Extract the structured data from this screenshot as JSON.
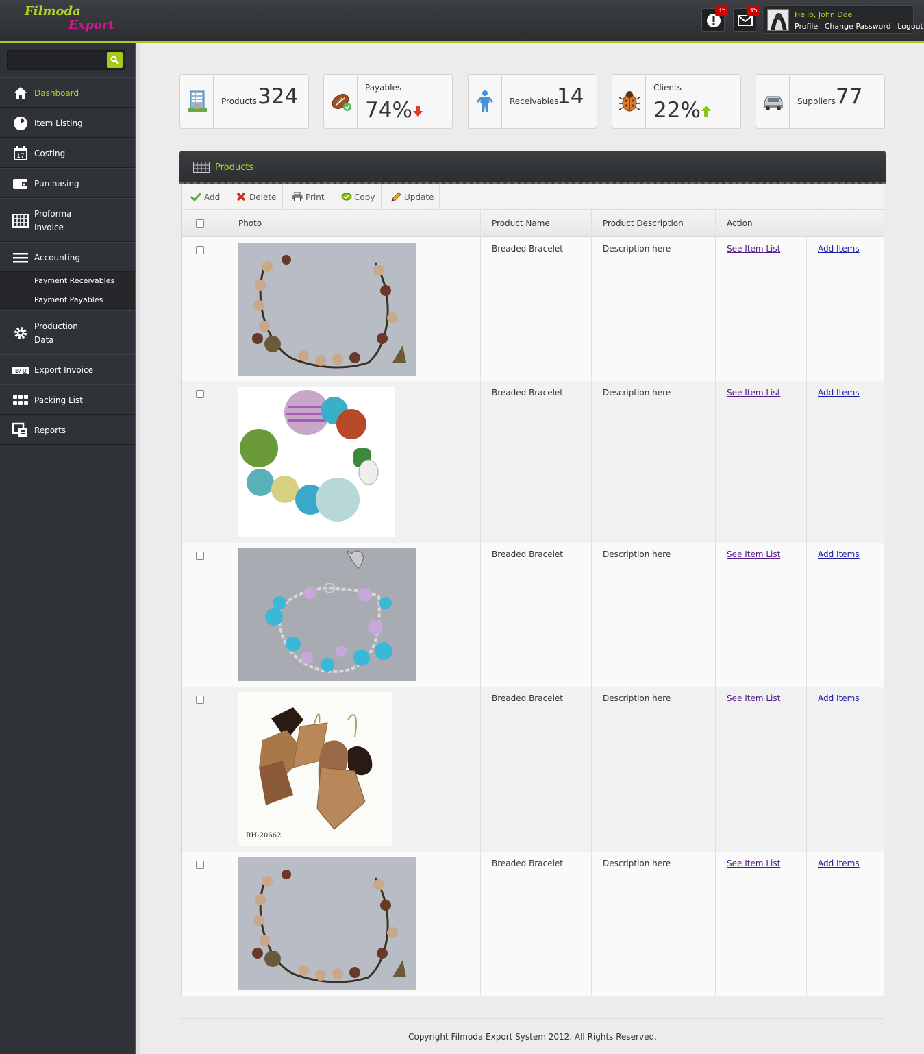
{
  "brand": {
    "line1": "Filmoda",
    "line2": "Export"
  },
  "header": {
    "alerts_count": "35",
    "messages_count": "35",
    "greeting": "Hello, John Doe",
    "links": [
      "Profile",
      "Change Password",
      "Logout"
    ]
  },
  "sidebar": {
    "items": [
      {
        "label": "Dashboard",
        "icon": "home-icon"
      },
      {
        "label": "Item Listing",
        "icon": "clock-icon"
      },
      {
        "label": "Costing",
        "icon": "calendar-icon"
      },
      {
        "label": "Purchasing",
        "icon": "wallet-icon"
      },
      {
        "label": "Proforma Invoice",
        "icon": "grid-icon"
      },
      {
        "label": "Accounting",
        "icon": "list-icon"
      },
      {
        "label": "Production Data",
        "icon": "gear-icon"
      },
      {
        "label": "Export Invoice",
        "icon": "biu-icon"
      },
      {
        "label": "Packing List",
        "icon": "apps-icon"
      },
      {
        "label": "Reports",
        "icon": "reports-icon"
      }
    ],
    "sub_items": [
      "Payment Receivables",
      "Payment Payables"
    ],
    "calendar_day": "17"
  },
  "stats": [
    {
      "label": "Products",
      "value": "324",
      "icon": "building-icon"
    },
    {
      "label": "Payables",
      "value": "74%",
      "trend": "down",
      "icon": "football-icon"
    },
    {
      "label": "Receivables",
      "value": "14",
      "icon": "person-icon"
    },
    {
      "label": "Clients",
      "value": "22%",
      "trend": "up",
      "icon": "bug-icon"
    },
    {
      "label": "Suppliers",
      "value": "77",
      "icon": "car-icon"
    }
  ],
  "panel": {
    "title": "Products",
    "toolbar": [
      "Add",
      "Delete",
      "Print",
      "Copy",
      "Update"
    ],
    "columns": [
      "Photo",
      "Product Name",
      "Product Description",
      "Action"
    ],
    "rows": [
      {
        "name": "Breaded Bracelet",
        "description": "Description here",
        "link1": "See Item List",
        "link2": "Add Items"
      },
      {
        "name": "Breaded Bracelet",
        "description": "Description here",
        "link1": "See Item List",
        "link2": "Add Items"
      },
      {
        "name": "Breaded Bracelet",
        "description": "Description here",
        "link1": "See Item List",
        "link2": "Add Items"
      },
      {
        "name": "Breaded Bracelet",
        "description": "Description here",
        "link1": "See Item List",
        "link2": "Add Items"
      },
      {
        "name": "Breaded Bracelet",
        "description": "Description here",
        "link1": "See Item List",
        "link2": "Add Items"
      }
    ],
    "photo_caption_4": "RH-20662"
  },
  "footer": "Copyright Filmoda Export System 2012. All Rights Reserved.",
  "colors": {
    "accent": "#a8c81a",
    "brand_pink": "#d2188f",
    "sidebar": "#2f3236"
  }
}
